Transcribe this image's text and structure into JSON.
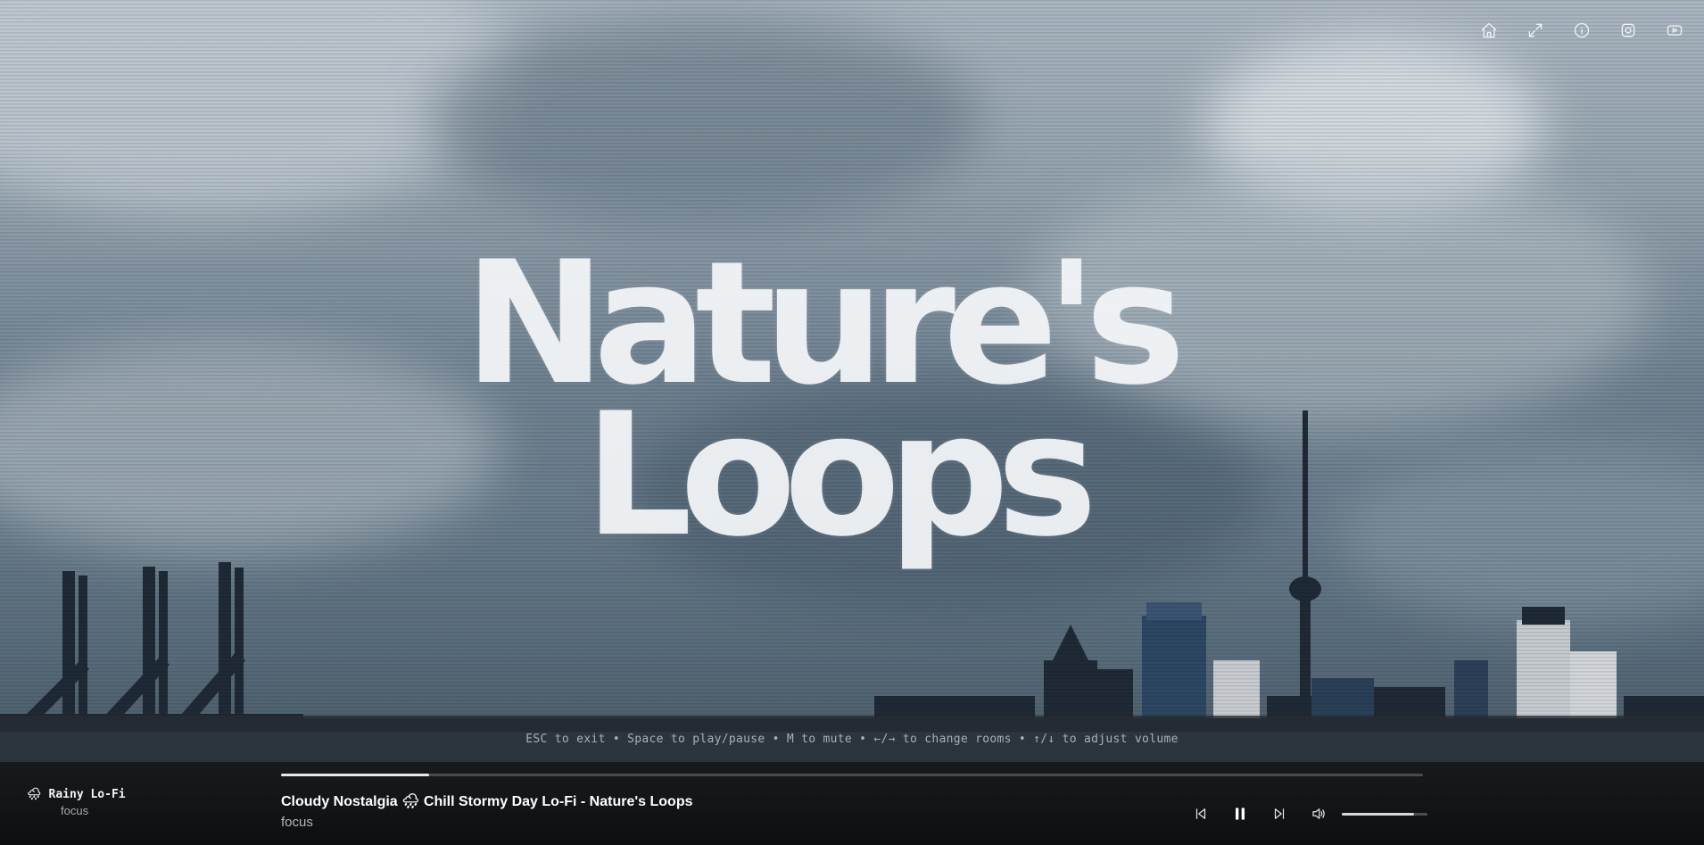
{
  "logo": {
    "line1": "Nature's",
    "line2": "Loops"
  },
  "topbar": {
    "buttons": [
      {
        "name": "home-button",
        "icon": "home-icon"
      },
      {
        "name": "fullscreen-button",
        "icon": "expand-icon"
      },
      {
        "name": "info-button",
        "icon": "info-icon"
      },
      {
        "name": "instagram-button",
        "icon": "instagram-icon"
      },
      {
        "name": "youtube-button",
        "icon": "youtube-icon"
      }
    ]
  },
  "shortcuts": {
    "text": "ESC to exit • Space to play/pause • M to mute • ←/→ to change rooms • ↑/↓ to adjust volume"
  },
  "room": {
    "icon": "🌧",
    "title": "Rainy Lo-Fi",
    "subtitle": "focus"
  },
  "track": {
    "title": "Cloudy Nostalgia 🌧 Chill Stormy Day Lo-Fi - Nature's Loops",
    "subtitle": "focus"
  },
  "player": {
    "progress": 0.13,
    "volume": 0.84,
    "state": "playing"
  },
  "colors": {
    "bar_bg": "#0d0e10",
    "accent": "#e8e8e8",
    "shortcut_text": "#a9b0b7"
  }
}
